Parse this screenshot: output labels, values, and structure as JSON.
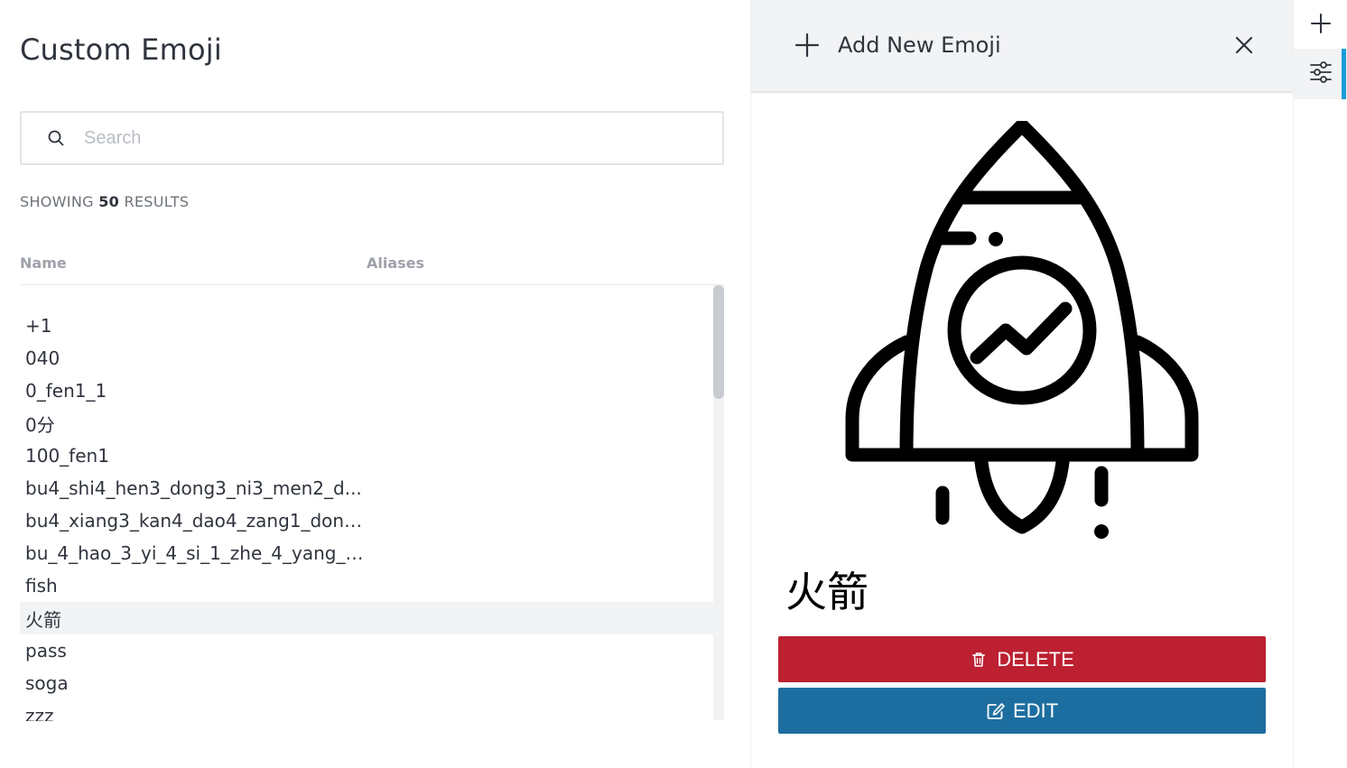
{
  "page": {
    "title": "Custom Emoji"
  },
  "search": {
    "placeholder": "Search",
    "value": ""
  },
  "results": {
    "prefix": "SHOWING",
    "count": "50",
    "suffix": "RESULTS"
  },
  "table": {
    "columns": [
      "Name",
      "Aliases"
    ],
    "rows": [
      {
        "name": "+1",
        "aliases": "",
        "selected": false
      },
      {
        "name": "040",
        "aliases": "",
        "selected": false
      },
      {
        "name": "0_fen1_1",
        "aliases": "",
        "selected": false
      },
      {
        "name": "0分",
        "aliases": "",
        "selected": false
      },
      {
        "name": "100_fen1",
        "aliases": "",
        "selected": false
      },
      {
        "name": "bu4_shi4_hen3_dong3_ni3_men2_d...",
        "aliases": "",
        "selected": false
      },
      {
        "name": "bu4_xiang3_kan4_dao4_zang1_dong...",
        "aliases": "",
        "selected": false
      },
      {
        "name": "bu_4_hao_3_yi_4_si_1_zhe_4_yang_4_...",
        "aliases": "",
        "selected": false
      },
      {
        "name": "fish",
        "aliases": "",
        "selected": false
      },
      {
        "name": "火箭",
        "aliases": "",
        "selected": true
      },
      {
        "name": "pass",
        "aliases": "",
        "selected": false
      },
      {
        "name": "soga",
        "aliases": "",
        "selected": false
      },
      {
        "name": "zzz",
        "aliases": "",
        "selected": false
      }
    ]
  },
  "detail": {
    "header_title": "Add New Emoji",
    "emoji_name": "火箭",
    "delete_label": "DELETE",
    "edit_label": "EDIT",
    "preview_icon": "rocket-icon"
  },
  "toolbar": {
    "items": [
      {
        "icon": "plus-icon",
        "active": false
      },
      {
        "icon": "sliders-icon",
        "active": true
      }
    ]
  },
  "colors": {
    "delete": "#bc2031",
    "edit": "#1d6ea0",
    "accent": "#1d9bd8",
    "header_bg": "#f2f3f5"
  }
}
